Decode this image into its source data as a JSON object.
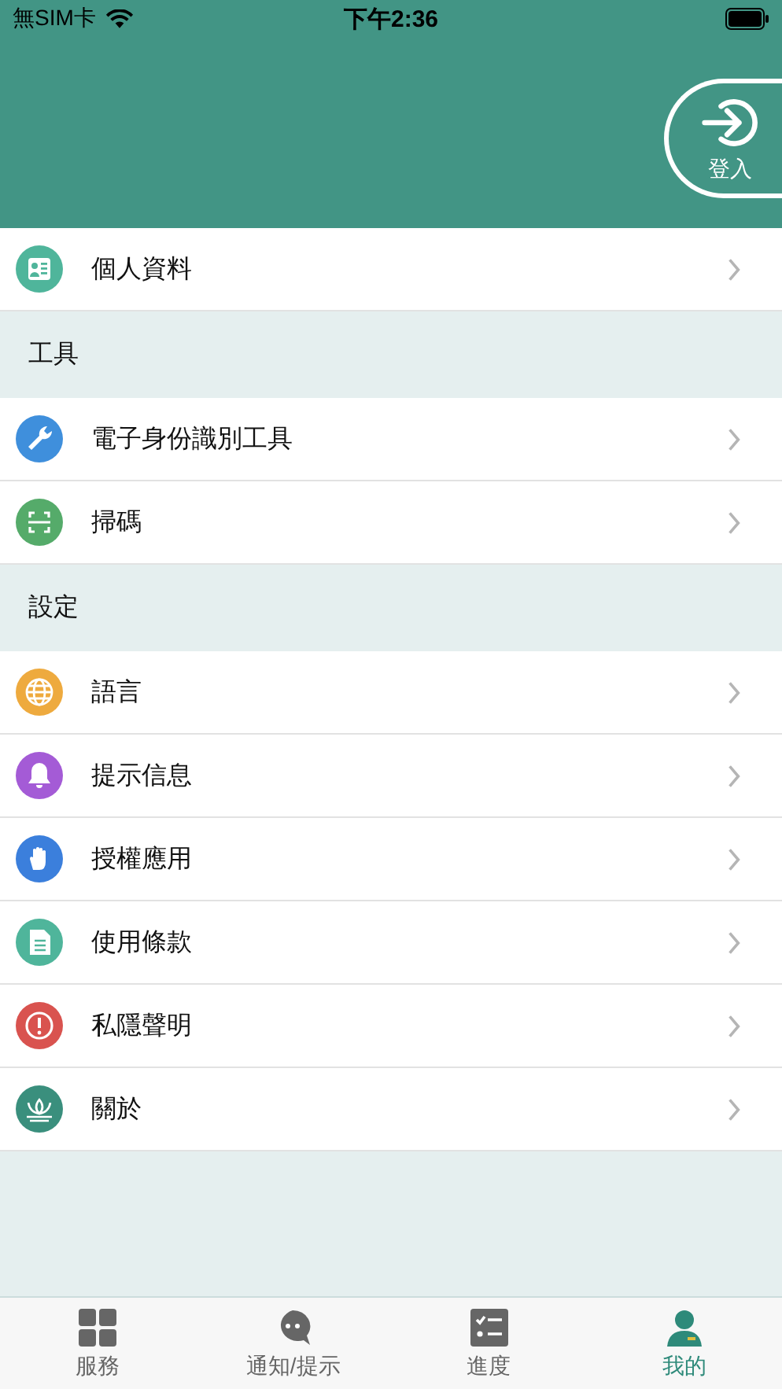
{
  "status_bar": {
    "carrier": "無SIM卡",
    "time": "下午2:36"
  },
  "header": {
    "login_button": "登入"
  },
  "sections": [
    {
      "items": [
        {
          "label": "個人資料",
          "kind": "profile",
          "color": "#4fb59b"
        }
      ]
    },
    {
      "title": "工具",
      "items": [
        {
          "label": "電子身份識別工具",
          "kind": "wrench",
          "color": "#3f8fdc"
        },
        {
          "label": "掃碼",
          "kind": "scan",
          "color": "#55ab6a"
        }
      ]
    },
    {
      "title": "設定",
      "items": [
        {
          "label": "語言",
          "kind": "globe",
          "color": "#eeaa3e"
        },
        {
          "label": "提示信息",
          "kind": "bell",
          "color": "#a45bd6"
        },
        {
          "label": "授權應用",
          "kind": "hand",
          "color": "#3b7fdc"
        },
        {
          "label": "使用條款",
          "kind": "document",
          "color": "#4fb59b"
        },
        {
          "label": "私隱聲明",
          "kind": "alert",
          "color": "#d9534f"
        },
        {
          "label": "關於",
          "kind": "lotus",
          "color": "#3a8f7d"
        }
      ]
    }
  ],
  "tab_bar": [
    {
      "label": "服務",
      "kind": "grid",
      "selected": false
    },
    {
      "label": "通知/提示",
      "kind": "chat",
      "selected": false
    },
    {
      "label": "進度",
      "kind": "checklist",
      "selected": false
    },
    {
      "label": "我的",
      "kind": "person",
      "selected": true
    }
  ]
}
